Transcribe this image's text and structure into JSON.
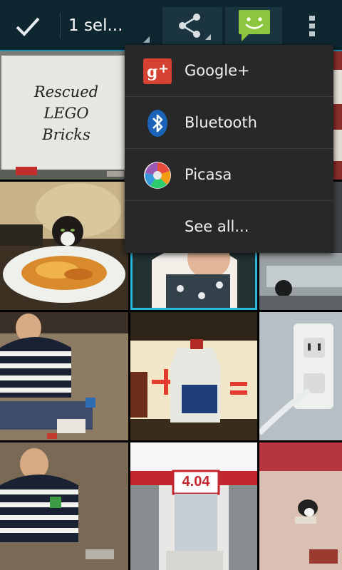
{
  "actionbar": {
    "selection_label": "1 sel...",
    "done_icon": "checkmark-icon",
    "share_icon": "share-icon",
    "messaging_icon": "messaging-icon",
    "overflow_icon": "overflow-menu-icon"
  },
  "share_menu": {
    "items": [
      {
        "label": "Google+",
        "icon": "google-plus-icon"
      },
      {
        "label": "Bluetooth",
        "icon": "bluetooth-icon"
      },
      {
        "label": "Picasa",
        "icon": "picasa-icon"
      },
      {
        "label": "See all...",
        "icon": ""
      }
    ]
  },
  "photos": {
    "whiteboard_text": [
      "Rescued",
      "LEGO",
      "Bricks"
    ],
    "price_sign": "4.04",
    "selected_count": 1
  },
  "colors": {
    "actionbar_bg": "#0d262f",
    "accent": "#29b8dc",
    "menu_bg": "#282828",
    "messaging_green": "#8cc63f"
  }
}
